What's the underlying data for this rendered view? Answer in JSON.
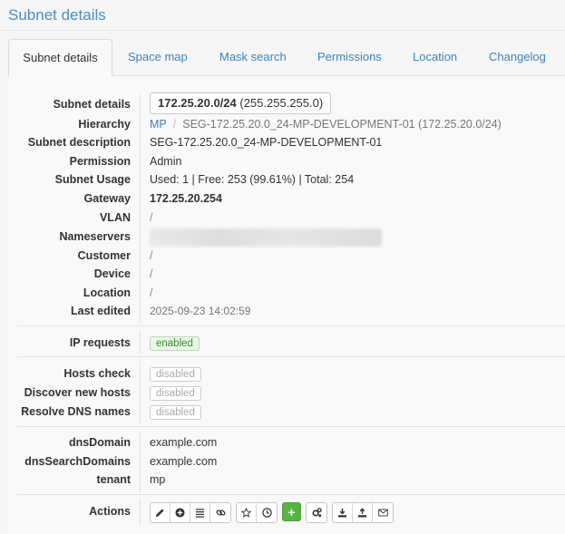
{
  "page": {
    "title": "Subnet details"
  },
  "tabs": [
    {
      "label": "Subnet details",
      "active": true
    },
    {
      "label": "Space map"
    },
    {
      "label": "Mask search"
    },
    {
      "label": "Permissions"
    },
    {
      "label": "Location"
    },
    {
      "label": "Changelog"
    }
  ],
  "details": {
    "subnet": {
      "label": "Subnet details",
      "address": "172.25.20.0/24",
      "mask": "(255.255.255.0)"
    },
    "hierarchy": {
      "label": "Hierarchy",
      "parent": "MP",
      "separator": "/",
      "current": "SEG-172.25.20.0_24-MP-DEVELOPMENT-01 (172.25.20.0/24)"
    },
    "description": {
      "label": "Subnet description",
      "value": "SEG-172.25.20.0_24-MP-DEVELOPMENT-01"
    },
    "permission": {
      "label": "Permission",
      "value": "Admin"
    },
    "usage": {
      "label": "Subnet Usage",
      "value": "Used: 1 | Free: 253 (99.61%) | Total: 254"
    },
    "gateway": {
      "label": "Gateway",
      "value": "172.25.20.254"
    },
    "vlan": {
      "label": "VLAN",
      "value": "/"
    },
    "nameservers": {
      "label": "Nameservers"
    },
    "customer": {
      "label": "Customer",
      "value": "/"
    },
    "device": {
      "label": "Device",
      "value": "/"
    },
    "location": {
      "label": "Location",
      "value": "/"
    },
    "last_edited": {
      "label": "Last edited",
      "value": "2025-09-23 14:02:59"
    }
  },
  "ip_requests": {
    "label": "IP requests",
    "status": "enabled"
  },
  "scanning": {
    "hosts_check": {
      "label": "Hosts check",
      "status": "disabled"
    },
    "discover": {
      "label": "Discover new hosts",
      "status": "disabled"
    },
    "resolve_dns": {
      "label": "Resolve DNS names",
      "status": "disabled"
    }
  },
  "custom_fields": {
    "dns_domain": {
      "label": "dnsDomain",
      "value": "example.com"
    },
    "dns_search": {
      "label": "dnsSearchDomains",
      "value": "example.com"
    },
    "tenant": {
      "label": "tenant",
      "value": "mp"
    }
  },
  "actions": {
    "label": "Actions",
    "groups": [
      [
        "edit-icon",
        "plus-circle-icon",
        "list-icon",
        "link-icon"
      ],
      [
        "star-icon",
        "clock-icon"
      ],
      [
        "plus-icon"
      ],
      [
        "cogs-icon"
      ],
      [
        "download-icon",
        "upload-icon",
        "envelope-icon"
      ]
    ],
    "colors": {
      "add_button": "#57b346"
    }
  }
}
